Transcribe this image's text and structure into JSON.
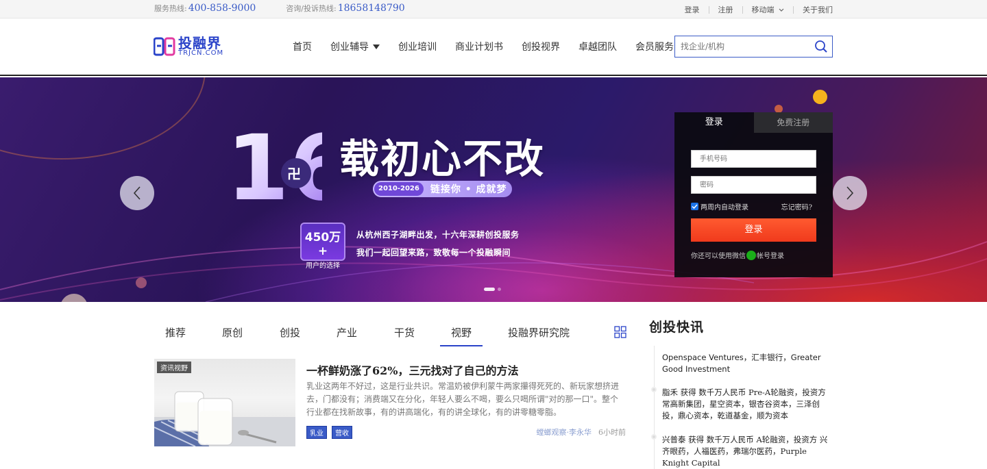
{
  "topbar": {
    "service_label": "服务热线:",
    "service_phone": "400-858-9000",
    "consult_label": "咨询/投诉热线:",
    "consult_phone": "18658148790",
    "links": [
      "登录",
      "注册",
      "移动端",
      "关于我们"
    ]
  },
  "header": {
    "logo_cn": "投融界",
    "logo_en": "TRJCN.COM",
    "nav": [
      "首页",
      "创业辅导",
      "创业培训",
      "商业计划书",
      "创投视界",
      "卓越团队",
      "会员服务"
    ],
    "search_placeholder": "找企业/机构"
  },
  "banner": {
    "big_number": "16",
    "slogan": "载初心不改",
    "years": "2010-2026",
    "tagline": "链接你 • 成就梦",
    "users_count": "450万+",
    "users_label": "用户的选择",
    "line1": "从杭州西子湖畔出发，十六年深耕创投服务",
    "line2": "我们一起回望来路，致敬每一个投融瞬间"
  },
  "login": {
    "tab_login": "登录",
    "tab_register": "免费注册",
    "phone_placeholder": "手机号码",
    "password_placeholder": "密码",
    "remember": "两周内自动登录",
    "forgot": "忘记密码?",
    "submit": "登录",
    "wechat_prefix": "你还可以使用微信",
    "wechat_suffix": "帐号登录"
  },
  "category_tabs": [
    "推荐",
    "原创",
    "创投",
    "产业",
    "干货",
    "视野",
    "投融界研究院"
  ],
  "active_tab": "视野",
  "article": {
    "thumb_tag": "资讯视野",
    "title": "一杯鲜奶涨了62%，三元找对了自己的方法",
    "summary": "乳业这两年不好过，这是行业共识。常温奶被伊利蒙牛两家攥得死死的、新玩家想挤进去，门都没有；消费端又在分化，年轻人要么不喝，要么只喝所谓\"对的那一口\"。整个行业都在找新故事，有的讲高端化，有的讲全球化，有的讲零糖零脂。",
    "tags": [
      "乳业",
      "营收"
    ],
    "author": "螳螂观察·李永华",
    "time": "6小时前"
  },
  "flash": {
    "title": "创投快讯",
    "items": [
      "Openspace Ventures，汇丰银行，Greater Good Investment",
      "脂禾 获得 数千万人民币 Pre-A轮融资，投资方 常高新集团，星空资本，银杏谷资本，三泽创投，鼎心资本，乾道基金，顺为资本",
      "兴普泰 获得 数千万人民币 A轮融资，投资方 兴齐眼药，人福医药，弗瑞尔医药，Purple Knight Capital"
    ]
  },
  "colors": {
    "brand_blue": "#2a43c9",
    "login_button": "#f03a1c",
    "tag_blue": "#3a5bc7"
  }
}
